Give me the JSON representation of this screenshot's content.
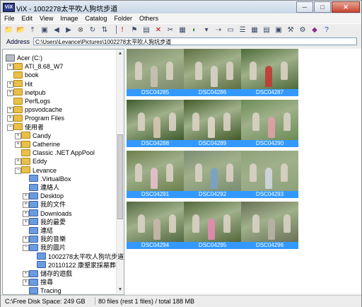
{
  "window": {
    "title": "ViX - 1002278太平吹人狗坑步道",
    "app_icon": "ViX",
    "min": "─",
    "max": "□",
    "close": "✕"
  },
  "menu": [
    "File",
    "Edit",
    "View",
    "Image",
    "Catalog",
    "Folder",
    "Others"
  ],
  "toolbar_icons": [
    "new-folder-icon",
    "open-folder-icon",
    "folder-up-icon",
    "image-icon",
    "back-icon",
    "forward-icon",
    "stop-icon",
    "refresh-icon",
    "sort-icon",
    "separator-a",
    "info-icon",
    "flag-icon",
    "slideshow-icon",
    "delete-icon",
    "cut-icon",
    "paste-icon",
    "color-icon",
    "dropdown-icon",
    "move-icon",
    "thumb-size-icon",
    "view-list-icon",
    "view-thumbs-icon",
    "view-detail-icon",
    "view-large-icon",
    "tools-icon",
    "settings-icon",
    "catalog-icon",
    "help-icon"
  ],
  "address": {
    "label": "Address",
    "value": "C:\\Users\\Levance\\Pictures\\1002278太平吹人狗坑步道"
  },
  "tree": [
    {
      "label": "Acer (C:)",
      "level": 0,
      "pm": "-"
    },
    {
      "label": "ATI_8.68_W7",
      "level": 1,
      "pm": "+"
    },
    {
      "label": "book",
      "level": 1,
      "pm": ""
    },
    {
      "label": "Hit",
      "level": 1,
      "pm": "+"
    },
    {
      "label": "inetpub",
      "level": 1,
      "pm": "+"
    },
    {
      "label": "PerfLogs",
      "level": 1,
      "pm": ""
    },
    {
      "label": "ppsvodcache",
      "level": 1,
      "pm": "+"
    },
    {
      "label": "Program Files",
      "level": 1,
      "pm": "+"
    },
    {
      "label": "使用者",
      "level": 1,
      "pm": "-"
    },
    {
      "label": "Candy",
      "level": 2,
      "pm": "+"
    },
    {
      "label": "Catherine",
      "level": 2,
      "pm": "+"
    },
    {
      "label": "Classic .NET AppPool",
      "level": 2,
      "pm": ""
    },
    {
      "label": "Eddy",
      "level": 2,
      "pm": "+"
    },
    {
      "label": "Levance",
      "level": 2,
      "pm": "-"
    },
    {
      "label": ".VirtualBox",
      "level": 3,
      "pm": ""
    },
    {
      "label": "連絡人",
      "level": 3,
      "pm": ""
    },
    {
      "label": "Desktop",
      "level": 3,
      "pm": "+"
    },
    {
      "label": "我的文件",
      "level": 3,
      "pm": "+"
    },
    {
      "label": "Downloads",
      "level": 3,
      "pm": "+"
    },
    {
      "label": "我的最愛",
      "level": 3,
      "pm": "+"
    },
    {
      "label": "連結",
      "level": 3,
      "pm": ""
    },
    {
      "label": "我的音樂",
      "level": 3,
      "pm": "+"
    },
    {
      "label": "我的圖片",
      "level": 3,
      "pm": "-"
    },
    {
      "label": "1002278太平吹人狗坑步道",
      "level": 4,
      "pm": ""
    },
    {
      "label": "20110122 康墾家採墓葬",
      "level": 4,
      "pm": ""
    },
    {
      "label": "儲存的遊戲",
      "level": 3,
      "pm": "+"
    },
    {
      "label": "搜尋",
      "level": 3,
      "pm": "+"
    },
    {
      "label": "Tracing",
      "level": 3,
      "pm": ""
    }
  ],
  "photos": [
    {
      "name": "DSC04285",
      "bg": "#7b8a6a",
      "accent": "#c9c1b2"
    },
    {
      "name": "DSC04286",
      "bg": "#5e7042",
      "accent": "#d8d4c8"
    },
    {
      "name": "DSC04287",
      "bg": "#4d6b3a",
      "accent": "#c33a34"
    },
    {
      "name": "DSC04288",
      "bg": "#3f5b2e",
      "accent": "#d6c7b1"
    },
    {
      "name": "DSC04289",
      "bg": "#425a2a",
      "accent": "#e2d8c9"
    },
    {
      "name": "DSC04290",
      "bg": "#6b8c55",
      "accent": "#e0a0a8"
    },
    {
      "name": "DSC04291",
      "bg": "#6c7f4b",
      "accent": "#e8c0cf"
    },
    {
      "name": "DSC04292",
      "bg": "#7b8d73",
      "accent": "#7aa1c8"
    },
    {
      "name": "DSC04293",
      "bg": "#8ea27a",
      "accent": "#cfd7df"
    },
    {
      "name": "DSC04294",
      "bg": "#536a43",
      "accent": "#c8b8a8"
    },
    {
      "name": "DSC04295",
      "bg": "#54683b",
      "accent": "#e38ab0"
    },
    {
      "name": "DSC04296",
      "bg": "#6a6f58",
      "accent": "#b9b2a4"
    }
  ],
  "status": {
    "disk": "C:\\Free Disk Space: 249 GB",
    "files": "80 files (rest 1 files) / total 188 MB"
  }
}
